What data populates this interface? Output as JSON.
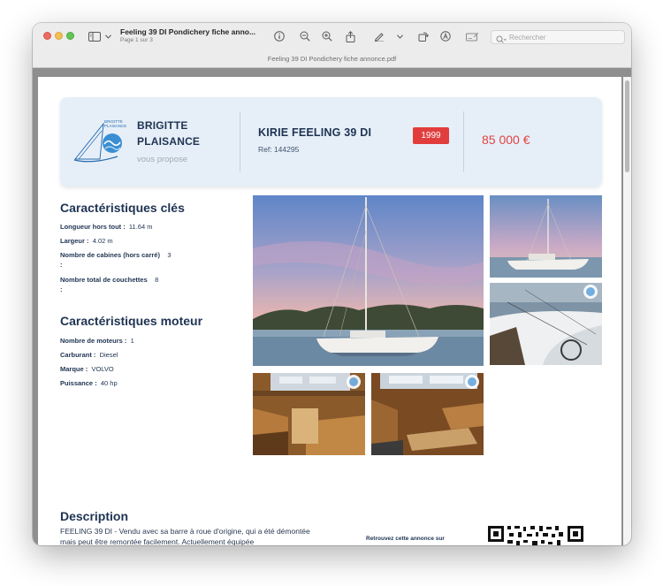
{
  "window": {
    "doc_title": "Feeling 39 DI Pondichery fiche anno...",
    "page_indicator": "Page 1 sur 3",
    "tab_filename": "Feeling 39 DI Pondichery fiche annonce.pdf",
    "search_placeholder": "Rechercher"
  },
  "toolbar": {
    "icons": [
      "sidebar-icon",
      "chevron-down-icon",
      "info-icon",
      "zoom-out-icon",
      "zoom-in-icon",
      "share-icon",
      "pen-icon",
      "chevron-down-icon",
      "rotate-icon",
      "markup-icon",
      "form-icon",
      "search-icon"
    ]
  },
  "header": {
    "logo_text": "BRIGITTE PLAISANCE",
    "brand_line1": "BRIGITTE",
    "brand_line2": "PLAISANCE",
    "brand_sub": "vous propose",
    "boat_name": "KIRIE FEELING 39 DI",
    "ref": "Ref: 144295",
    "year": "1999",
    "price": "85 000 €"
  },
  "key_specs": {
    "title": "Caractéristiques clés",
    "items": [
      {
        "label": "Longueur hors tout :",
        "value": "11.64 m"
      },
      {
        "label": "Largeur :",
        "value": "4.02 m"
      },
      {
        "label": "Nombre de cabines (hors carré)",
        "value": "3"
      },
      {
        "label": "Nombre total de couchettes",
        "value": "8"
      }
    ]
  },
  "engine_specs": {
    "title": "Caractéristiques moteur",
    "items": [
      {
        "label": "Nombre de moteurs :",
        "value": "1"
      },
      {
        "label": "Carburant :",
        "value": "Diesel"
      },
      {
        "label": "Marque :",
        "value": "VOLVO"
      },
      {
        "label": "Puissance :",
        "value": "40 hp"
      }
    ]
  },
  "colon_mark": ":",
  "description": {
    "title": "Description",
    "text": "FEELING 39 DI - Vendu avec sa barre à roue d'origine, qui a été démontée mais peut être remontée facilement. Actuellement équipée",
    "qr_caption": "Retrouvez cette annonce sur"
  },
  "colors": {
    "navy": "#1e3352",
    "badge_red": "#e23d3d",
    "price_red": "#e24343",
    "card_bg": "#e6eff8"
  }
}
